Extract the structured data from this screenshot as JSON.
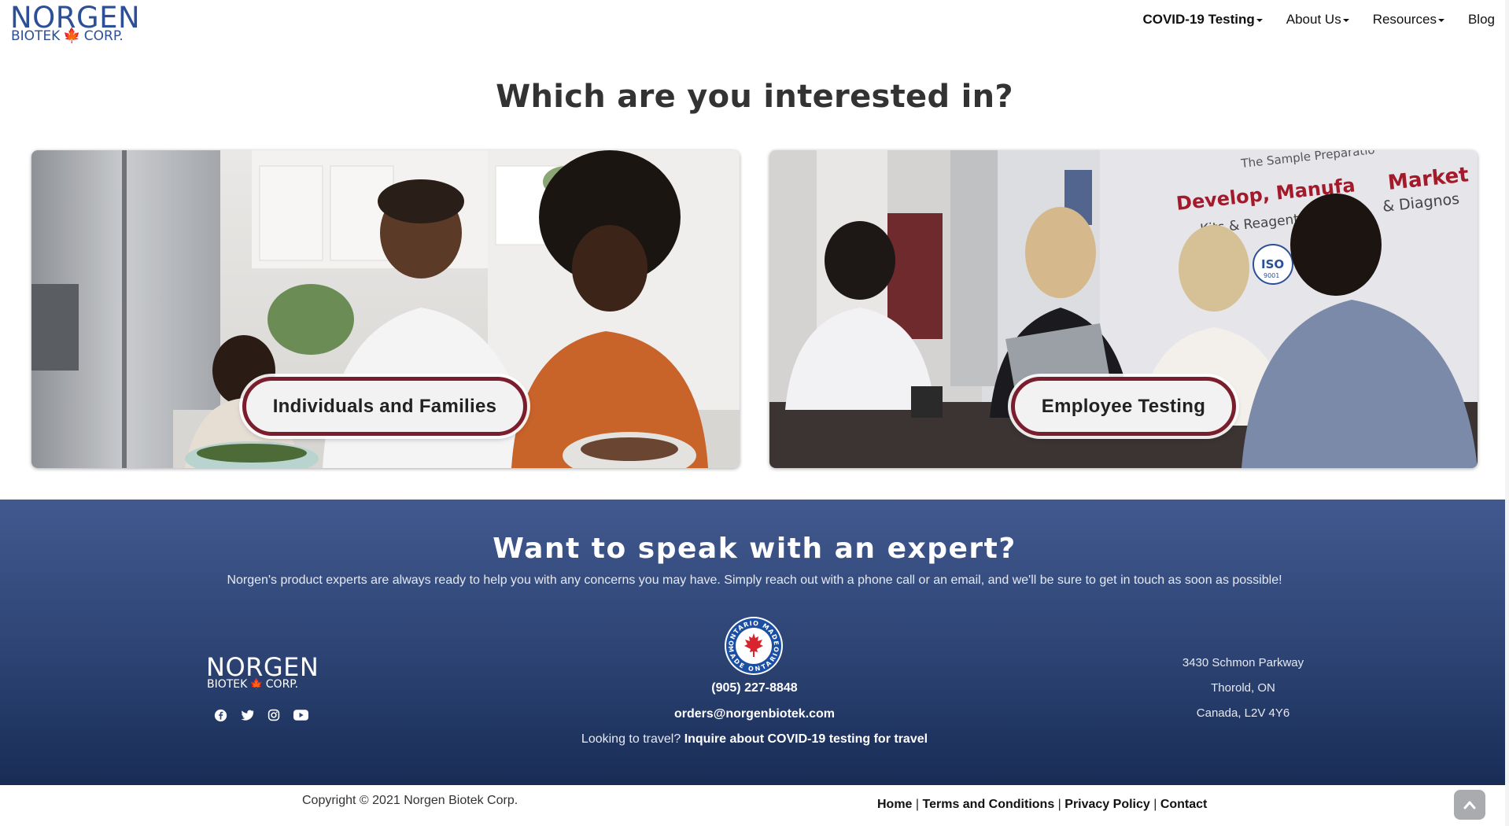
{
  "header": {
    "logo_top": "NORGEN",
    "logo_bottom_left": "BIOTEK",
    "logo_bottom_right": "CORP.",
    "nav": [
      {
        "label": "COVID-19 Testing",
        "dropdown": true
      },
      {
        "label": "About Us",
        "dropdown": true
      },
      {
        "label": "Resources",
        "dropdown": true
      },
      {
        "label": "Blog",
        "dropdown": false
      }
    ]
  },
  "main": {
    "title": "Which are you interested in?",
    "cards": [
      {
        "button_label": "Individuals and Families"
      },
      {
        "button_label": "Employee Testing"
      }
    ],
    "office_sign": {
      "line1": "The Sample Preparatio",
      "line2": "Develop, Manufa",
      "line3": "Market",
      "line4": "Kits & Reagents",
      "line5": "& Diagnos",
      "iso": "ISO",
      "iso_sub": "9001"
    }
  },
  "expert": {
    "title": "Want to speak with an expert?",
    "subtitle": "Norgen's product experts are always ready to help you with any concerns you may have. Simply reach out with a phone call or an email, and we'll be sure to get in touch as soon as possible!",
    "badge_top": "ONTARIO MADE",
    "badge_bottom": "MADE ONTARIO",
    "phone": "(905) 227-8848",
    "email": "orders@norgenbiotek.com",
    "travel_prefix": "Looking to travel?",
    "travel_link": "Inquire about COVID-19 testing for travel",
    "address": [
      "3430 Schmon Parkway",
      "Thorold, ON",
      "Canada, L2V 4Y6"
    ],
    "socials": [
      "facebook-icon",
      "twitter-icon",
      "instagram-icon",
      "youtube-icon"
    ]
  },
  "footer": {
    "copyright": "Copyright © 2021 Norgen Biotek Corp.",
    "links": [
      "Home",
      "Terms and Conditions",
      "Privacy Policy",
      "Contact"
    ]
  },
  "colors": {
    "brand_blue": "#2d4f97",
    "maple_red": "#d9232e",
    "button_border": "#7a1d2c",
    "expert_bg_top": "#42598f",
    "expert_bg_bottom": "#182c55"
  }
}
